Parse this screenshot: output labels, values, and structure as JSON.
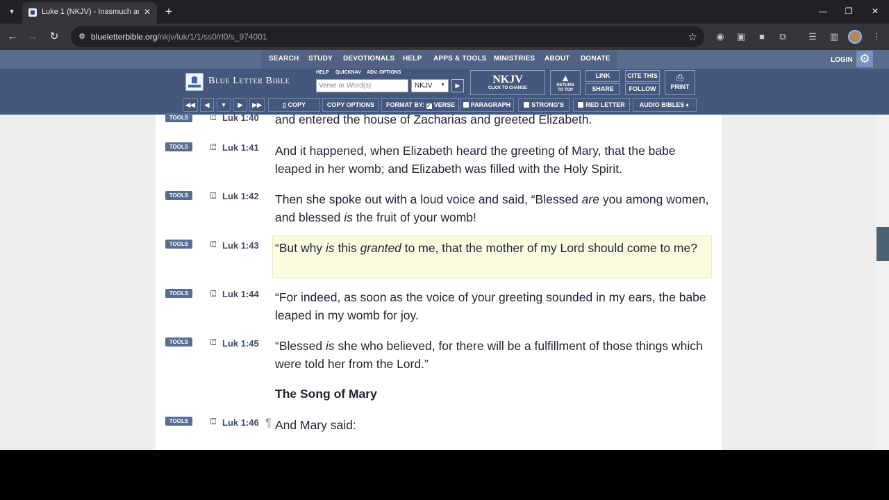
{
  "browser": {
    "tab_title": "Luke 1 (NKJV) - Inasmuch as ma",
    "url_host": "blueletterbible.org",
    "url_path": "/nkjv/luk/1/1/ss0/rl0/s_974001"
  },
  "site": {
    "topnav": [
      "SEARCH",
      "STUDY",
      "DEVOTIONALS",
      "HELP",
      "APPS & TOOLS",
      "MINISTRIES",
      "ABOUT",
      "DONATE"
    ],
    "login": "LOGIN",
    "logo": "Blue Letter Bible",
    "mini_links": [
      "HELP",
      "QUICKNAV",
      "ADV. OPTIONS"
    ],
    "search_placeholder": "Verse or Word(s)",
    "version": "NKJV",
    "version_button": {
      "label": "NKJV",
      "sub": "CLICK TO CHANGE"
    },
    "return_to_top": {
      "line1": "RETURN",
      "line2": "TO TOP"
    },
    "link": "LINK",
    "share": "SHARE",
    "cite": "CITE THIS",
    "follow": "FOLLOW",
    "print": "PRINT",
    "format_bar": {
      "copy": "COPY",
      "copy_options": "COPY OPTIONS",
      "format_by": "FORMAT BY:",
      "verse": "VERSE",
      "paragraph": "PARAGRAPH",
      "strongs": "STRONG'S",
      "red_letter": "RED LETTER",
      "audio_bibles": "AUDIO BIBLES"
    }
  },
  "tools_label": "TOOLS",
  "verses": [
    {
      "ref": "Luk 1:40",
      "text": "and entered the house of Zacharias and greeted Elizabeth."
    },
    {
      "ref": "Luk 1:41",
      "text": "And it happened, when Elizabeth heard the greeting of Mary, that the babe leaped in her womb; and Elizabeth was filled with the Holy Spirit."
    },
    {
      "ref": "Luk 1:42",
      "text_a": "Then she spoke out with a loud voice and said, “Blessed ",
      "italic_a": "are",
      "text_b": " you among women, and blessed ",
      "italic_b": "is",
      "text_c": " the fruit of your womb!"
    },
    {
      "ref": "Luk 1:43",
      "text_a": "“But why ",
      "italic_a": "is",
      "text_b": " this ",
      "italic_b": "granted",
      "text_c": " to me, that the mother of my Lord should come to me?"
    },
    {
      "ref": "Luk 1:44",
      "text": "“For indeed, as soon as the voice of your greeting sounded in my ears, the babe leaped in my womb for joy."
    },
    {
      "ref": "Luk 1:45",
      "text_a": "“Blessed ",
      "italic_a": "is",
      "text_b": " she who believed, for there will be a fulfillment of those things which were told her from the Lord.”"
    },
    {
      "ref": "Luk 1:46",
      "pilcrow": "¶",
      "text": "And Mary said:"
    }
  ],
  "section_heading": "The Song of Mary"
}
